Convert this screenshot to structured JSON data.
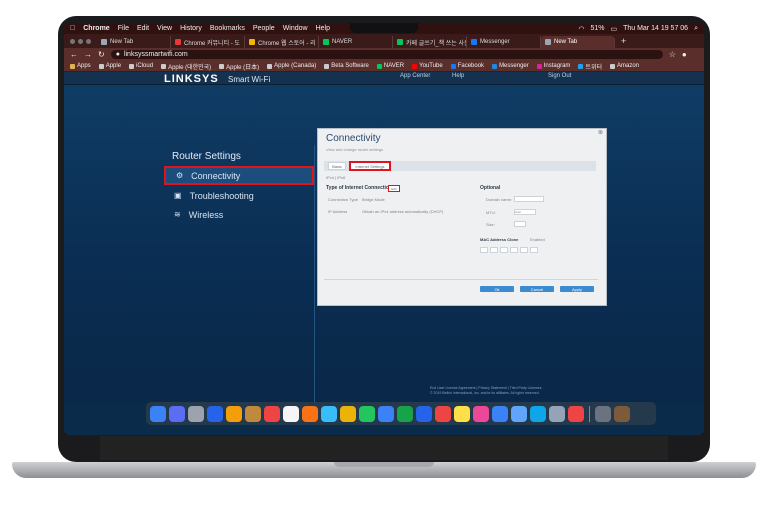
{
  "menubar": {
    "app": "Chrome",
    "items": [
      "File",
      "Edit",
      "View",
      "History",
      "Bookmarks",
      "People",
      "Window",
      "Help"
    ],
    "clock": "Thu Mar 14  19 57 06",
    "battery": "51%"
  },
  "tabs": [
    {
      "title": "New Tab",
      "color": "#9aa7b4"
    },
    {
      "title": "Chrome 커뮤니티 - 도",
      "color": "#e53935"
    },
    {
      "title": "Chrome 웹 스토어 - 리",
      "color": "#f4b400"
    },
    {
      "title": "NAVER",
      "color": "#03c75a"
    },
    {
      "title": "카페 글쓰기_책 쓰는 사는",
      "color": "#03c75a"
    },
    {
      "title": "Messenger",
      "color": "#1877f2"
    },
    {
      "title": "New Tab",
      "color": "#9aa7b4"
    }
  ],
  "address": {
    "url": "linksyssmartwifi.com"
  },
  "bookmarks": [
    {
      "label": "Apps",
      "color": "#e8b44a"
    },
    {
      "label": "Apple",
      "color": "#cccccc"
    },
    {
      "label": "iCloud",
      "color": "#cccccc"
    },
    {
      "label": "Apple (대한민국)",
      "color": "#cccccc"
    },
    {
      "label": "Apple (日本)",
      "color": "#cccccc"
    },
    {
      "label": "Apple (Canada)",
      "color": "#cccccc"
    },
    {
      "label": "Beta Software",
      "color": "#cccccc"
    },
    {
      "label": "NAVER",
      "color": "#03c75a"
    },
    {
      "label": "YouTube",
      "color": "#ff0000"
    },
    {
      "label": "Facebook",
      "color": "#1877f2"
    },
    {
      "label": "Messenger",
      "color": "#1e88e5"
    },
    {
      "label": "Instagram",
      "color": "#d6249f"
    },
    {
      "label": "트위터",
      "color": "#1da1f2"
    },
    {
      "label": "Amazon",
      "color": "#cccccc"
    }
  ],
  "header": {
    "logo": "LINKSYS",
    "product": "Smart Wi-Fi",
    "app_center": "App Center",
    "help": "Help",
    "sign_out": "Sign Out"
  },
  "sidebar": {
    "title": "Router Settings",
    "items": [
      {
        "label": "Connectivity",
        "selected": true
      },
      {
        "label": "Troubleshooting",
        "selected": false
      },
      {
        "label": "Wireless",
        "selected": false
      }
    ]
  },
  "dialog": {
    "title": "Connectivity",
    "subtitle": "View and change router settings",
    "tabs": [
      "Basic",
      "Internet Settings"
    ],
    "selected_tab": "Internet Settings",
    "ip_toggle": "IPv4  |  IPv6",
    "section_left": "Type of Internet Connection",
    "auto_label": "Edit",
    "connection_type_label": "Connection Type",
    "connection_type_value": "Bridge Mode",
    "ip_address_label": "IP Address",
    "ip_address_value": "Obtain an IPv4 address automatically (DHCP)",
    "section_right": "Optional",
    "domain_label": "Domain name:",
    "mtu_label": "MTU:",
    "mtu_value": "Auto",
    "size_label": "Size:",
    "mac_clone": "MAC Address Clone",
    "mac_state": "Enabled",
    "buttons": {
      "ok": "Ok",
      "cancel": "Cancel",
      "apply": "Apply"
    }
  },
  "footer": {
    "links": "End User License Agreement  |  Privacy Statement  |  Third Party Licenses",
    "copyright": "© 2019 Belkin International, Inc. and/or its affiliates. All rights reserved."
  },
  "dock": {
    "icon_colors": [
      "#3b82f6",
      "#5b6cf5",
      "#9ca3af",
      "#2563eb",
      "#f59e0b",
      "#c08a3e",
      "#ef4444",
      "#f5f5f5",
      "#f97316",
      "#38bdf8",
      "#eab308",
      "#22c55e",
      "#3b82f6",
      "#16a34a",
      "#2563eb",
      "#ef4444",
      "#fde047",
      "#ec4899",
      "#3b82f6",
      "#60a5fa",
      "#0ea5e9",
      "#94a3b8",
      "#ef4444",
      "#6b7280",
      "#7c5a3a"
    ]
  }
}
